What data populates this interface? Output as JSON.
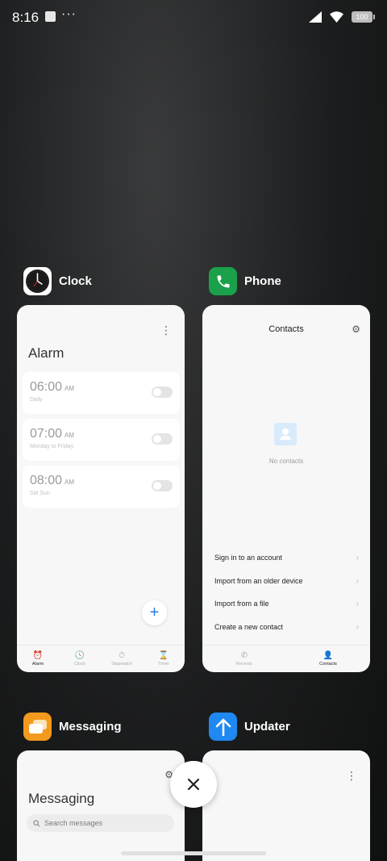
{
  "status_bar": {
    "time": "8:16",
    "dots": "···",
    "battery": "100"
  },
  "colors": {
    "phone_green": "#1aa14a",
    "messaging_orange": "#f39a1e",
    "updater_blue": "#1f88f2",
    "accent_blue": "#2d7be0"
  },
  "apps": {
    "clock": {
      "name": "Clock",
      "icon": "clock-icon",
      "screen_title": "Alarm",
      "alarms": [
        {
          "time": "06:00",
          "ampm": "AM",
          "repeat": "Daily"
        },
        {
          "time": "07:00",
          "ampm": "AM",
          "repeat": "Monday to Friday"
        },
        {
          "time": "08:00",
          "ampm": "AM",
          "repeat": "Sat Sun"
        }
      ],
      "add_label": "+",
      "nav": [
        {
          "label": "Alarm",
          "icon": "alarm-icon",
          "active": true
        },
        {
          "label": "Clock",
          "icon": "clock-icon",
          "active": false
        },
        {
          "label": "Stopwatch",
          "icon": "stopwatch-icon",
          "active": false
        },
        {
          "label": "Timer",
          "icon": "hourglass-icon",
          "active": false
        }
      ]
    },
    "phone": {
      "name": "Phone",
      "icon": "phone-icon",
      "screen_title": "Contacts",
      "empty_label": "No contacts",
      "actions": [
        "Sign in to an account",
        "Import from an older device",
        "Import from a file",
        "Create a new contact"
      ],
      "nav": [
        {
          "label": "Recents",
          "icon": "phone-icon",
          "active": false
        },
        {
          "label": "Contacts",
          "icon": "person-icon",
          "active": true
        }
      ]
    },
    "messaging": {
      "name": "Messaging",
      "icon": "chat-bubbles-icon",
      "screen_title": "Messaging",
      "search_placeholder": "Search messages"
    },
    "updater": {
      "name": "Updater",
      "icon": "arrow-up-icon"
    }
  }
}
